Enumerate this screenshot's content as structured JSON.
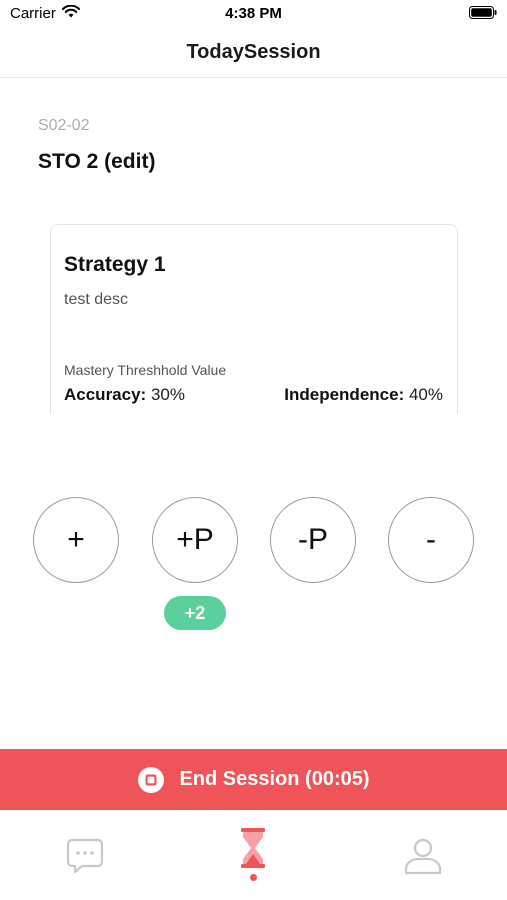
{
  "status_bar": {
    "carrier": "Carrier",
    "time": "4:38 PM",
    "icons": [
      "wifi-icon",
      "battery-icon"
    ]
  },
  "nav": {
    "title": "TodaySession"
  },
  "session": {
    "code": "S02-02",
    "sto_title": "STO 2 (edit)"
  },
  "strategy": {
    "title": "Strategy 1",
    "description": "test desc",
    "mastery_label": "Mastery Threshhold Value",
    "accuracy_key": "Accuracy:",
    "accuracy_value": "30%",
    "independence_key": "Independence:",
    "independence_value": "40%"
  },
  "trial_buttons": [
    {
      "label": "+"
    },
    {
      "label": "+P"
    },
    {
      "label": "-P"
    },
    {
      "label": "-"
    }
  ],
  "count_badge": "+2",
  "end_session": {
    "icon": "stop-icon",
    "label": "End Session (00:05)"
  },
  "tabs": [
    {
      "icon": "chat-icon",
      "active": false
    },
    {
      "icon": "hourglass-icon",
      "active": true
    },
    {
      "icon": "profile-icon",
      "active": false
    }
  ],
  "colors": {
    "accent": "#ee5458",
    "badge": "#5bd09a",
    "muted_text": "#a9aeb6",
    "inactive_icon": "#c8c8c8"
  }
}
